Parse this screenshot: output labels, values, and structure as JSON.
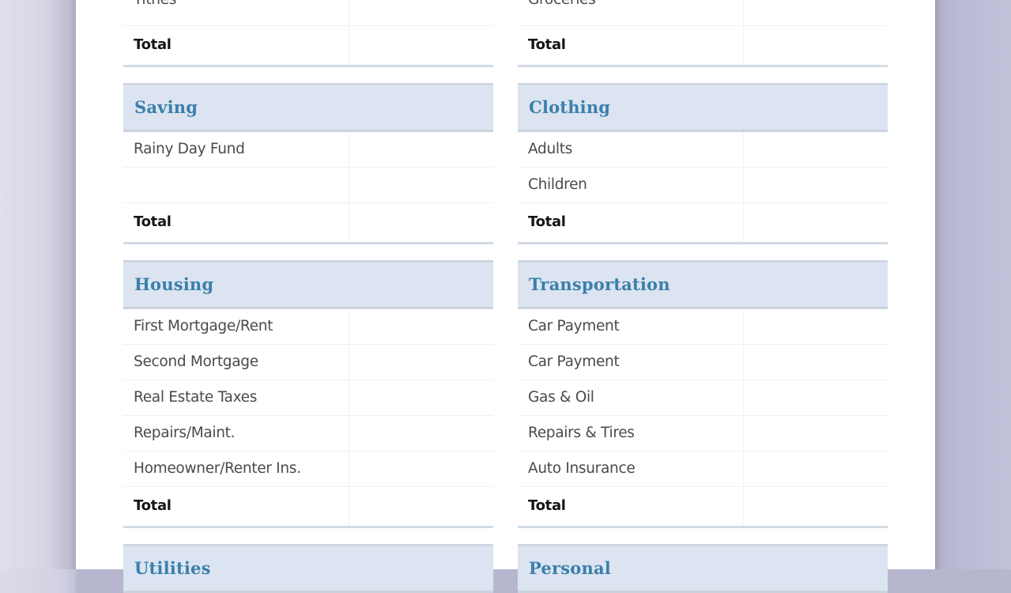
{
  "colors": {
    "header_bg": "#dbe4f0",
    "header_text": "#3b7fab",
    "row_text": "#4a4a4a",
    "total_text": "#151515"
  },
  "left_column": {
    "top_rows": [
      {
        "label": "Tithes"
      }
    ],
    "top_total": "Total",
    "sections": [
      {
        "title": "Saving",
        "rows": [
          "Rainy Day Fund",
          ""
        ],
        "total": "Total"
      },
      {
        "title": "Housing",
        "rows": [
          "First Mortgage/Rent",
          "Second Mortgage",
          "Real Estate Taxes",
          "Repairs/Maint.",
          "Homeowner/Renter Ins."
        ],
        "total": "Total"
      },
      {
        "title": "Utilities",
        "rows": [],
        "total": ""
      }
    ]
  },
  "right_column": {
    "top_rows": [
      {
        "label": "Groceries"
      }
    ],
    "top_total": "Total",
    "sections": [
      {
        "title": "Clothing",
        "rows": [
          "Adults",
          "Children"
        ],
        "total": "Total"
      },
      {
        "title": "Transportation",
        "rows": [
          "Car Payment",
          "Car Payment",
          "Gas & Oil",
          "Repairs & Tires",
          "Auto Insurance"
        ],
        "total": "Total"
      },
      {
        "title": "Personal",
        "rows": [],
        "total": ""
      }
    ]
  }
}
